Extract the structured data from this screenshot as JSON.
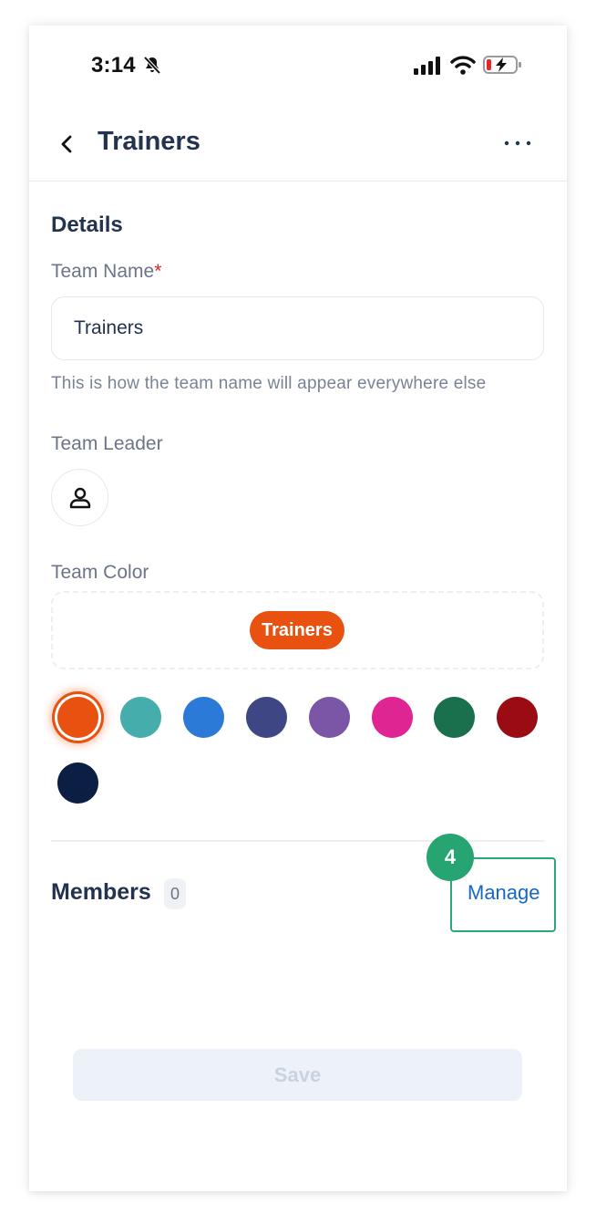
{
  "status_bar": {
    "time": "3:14",
    "icons": [
      "bell-off-icon",
      "signal-icon",
      "wifi-icon",
      "battery-charging-icon"
    ],
    "battery_color": "#e5262d"
  },
  "header": {
    "title": "Trainers",
    "back_icon": "chevron-left-icon",
    "more_icon": "more-horizontal-icon"
  },
  "details": {
    "section_title": "Details",
    "team_name": {
      "label": "Team Name",
      "required_mark": "*",
      "value": "Trainers",
      "helper": "This is how the team name will appear everywhere else"
    },
    "team_leader": {
      "label": "Team Leader",
      "icon": "user-icon"
    },
    "team_color": {
      "label": "Team Color",
      "preview_label": "Trainers",
      "selected": "#e8510f",
      "swatches": [
        "#e8510f",
        "#45adab",
        "#2c7ad8",
        "#3f4684",
        "#7b56a6",
        "#de2591",
        "#1a6f4d",
        "#9b0b14",
        "#0d1e45"
      ]
    }
  },
  "members": {
    "title": "Members",
    "count": "0",
    "manage_label": "Manage"
  },
  "tutorial": {
    "step": "4",
    "accent": "#26a472"
  },
  "footer": {
    "save_label": "Save"
  }
}
